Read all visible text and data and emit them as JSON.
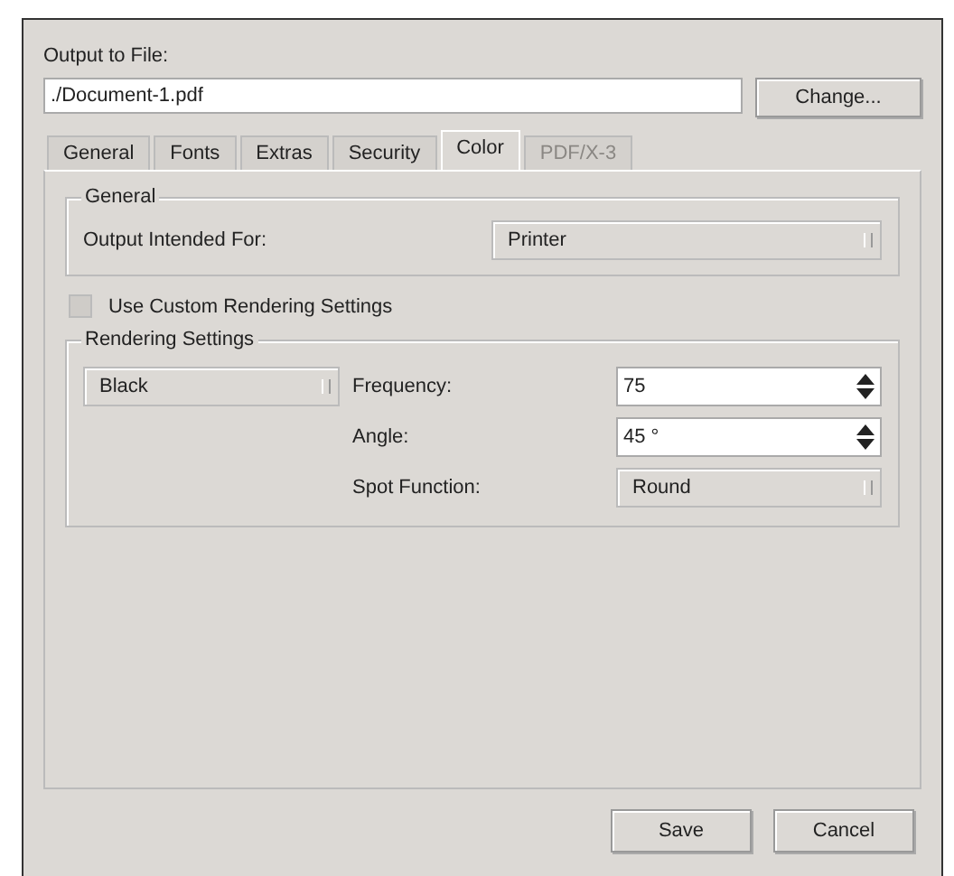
{
  "output": {
    "label": "Output to File:",
    "value": "./Document-1.pdf",
    "button": "Change..."
  },
  "tabs": [
    {
      "label": "General",
      "selected": false,
      "disabled": false
    },
    {
      "label": "Fonts",
      "selected": false,
      "disabled": false
    },
    {
      "label": "Extras",
      "selected": false,
      "disabled": false
    },
    {
      "label": "Security",
      "selected": false,
      "disabled": false
    },
    {
      "label": "Color",
      "selected": true,
      "disabled": false
    },
    {
      "label": "PDF/X-3",
      "selected": false,
      "disabled": true
    }
  ],
  "general_group": {
    "title": "General",
    "label": "Output Intended For:",
    "value": "Printer"
  },
  "custom_rendering": {
    "label": "Use Custom Rendering Settings",
    "checked": false
  },
  "rendering_group": {
    "title": "Rendering Settings",
    "color_select": "Black",
    "fields": [
      {
        "kind": "spin",
        "label": "Frequency:",
        "value": "75"
      },
      {
        "kind": "spin",
        "label": "Angle:",
        "value": "45 °"
      },
      {
        "kind": "combo",
        "label": "Spot Function:",
        "value": "Round"
      }
    ]
  },
  "buttons": [
    "Save",
    "Cancel"
  ]
}
